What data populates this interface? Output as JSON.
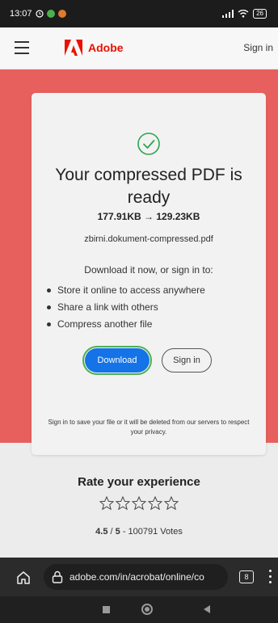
{
  "status_bar": {
    "time": "13:07",
    "battery": "26"
  },
  "header": {
    "brand": "Adobe",
    "sign_in": "Sign in"
  },
  "card": {
    "title": "Your compressed PDF is ready",
    "original_size": "177.91KB",
    "arrow": "→",
    "compressed_size": "129.23KB",
    "filename": "zbirni.dokument-compressed.pdf",
    "prompt": "Download it now, or sign in to:",
    "bullets": [
      "Store it online to access anywhere",
      "Share a link with others",
      "Compress another file"
    ],
    "download_label": "Download",
    "signin_label": "Sign in",
    "notice": "Sign in to save your file or it will be deleted from our servers to respect your privacy."
  },
  "rating": {
    "title": "Rate your experience",
    "score": "4.5",
    "separator": "/",
    "max": "5",
    "votes": "- 100791 Votes",
    "stars_filled": 0,
    "stars_total": 5
  },
  "browser": {
    "url": "adobe.com/in/acrobat/online/co",
    "tab_count": "8"
  },
  "colors": {
    "brand_red": "#eb1000",
    "band_red": "#e8605d",
    "download_blue": "#1473e6",
    "check_green": "#2ea44f",
    "focus_outline": "#4caf50"
  }
}
